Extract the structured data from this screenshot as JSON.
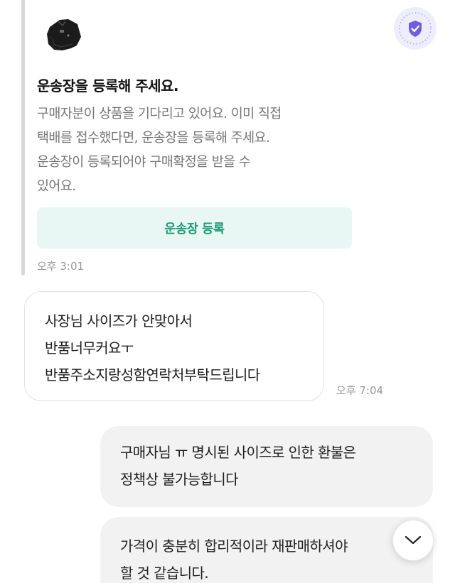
{
  "notice": {
    "title": "운송장을 등록해 주세요.",
    "body_lines": [
      "구매자분이 상품을 기다리고 있어요. 이미 직접",
      "택배를 접수했다면, 운송장을 등록해 주세요.",
      "운송장이 등록되어야 구매확정을 받을 수",
      "있어요."
    ],
    "button_label": "운송장 등록",
    "time": "오후 3:01",
    "product_icon": "jacket-thumbnail",
    "badge_icon": "shield-check-icon",
    "accent_color": "#1b9b74"
  },
  "messages": [
    {
      "direction": "incoming",
      "lines": [
        "사장님 사이즈가 안맞아서",
        "반품너무커요ㅜ",
        "반품주소지랑성함연락처부탁드립니다"
      ],
      "time": "오후 7:04"
    },
    {
      "direction": "outgoing",
      "lines": [
        "구매자님 ㅠ 명시된 사이즈로 인한 환불은",
        "정책상 불가능합니다"
      ]
    },
    {
      "direction": "outgoing",
      "lines": [
        "가격이 충분히 합리적이라 재판매하셔야",
        "할 것 같습니다."
      ]
    }
  ],
  "scroll_button_icon": "chevron-down-icon"
}
